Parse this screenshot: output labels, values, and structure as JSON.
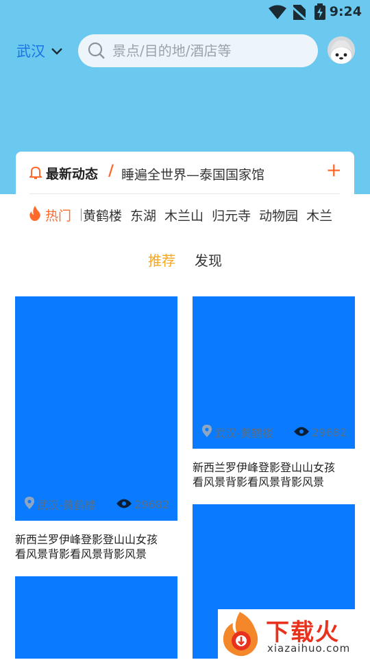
{
  "status_bar": {
    "time": "9:24",
    "icons": [
      "wifi-icon",
      "no-sim-icon",
      "battery-charging-icon"
    ]
  },
  "header": {
    "city": "武汉",
    "search_placeholder": "景点/目的地/酒店等",
    "colors": {
      "background": "#6bc8ee",
      "accent": "#1a73e8"
    }
  },
  "news": {
    "title": "最新动态",
    "text": "睡遍全世界—泰国国家馆",
    "accent_color": "#ff6a2b"
  },
  "hot": {
    "label": "热门",
    "items": [
      "黄鹤楼",
      "东湖",
      "木兰山",
      "归元寺",
      "动物园",
      "木兰"
    ]
  },
  "tabs": [
    {
      "label": "推荐",
      "active": true
    },
    {
      "label": "发现",
      "active": false
    }
  ],
  "cards": [
    {
      "location": "武汉-黄鹤楼",
      "views": "29682",
      "caption_line1": "新西兰罗伊峰登影登山山女孩",
      "caption_line2": "看风景背影看风景背影风景"
    },
    {
      "location": "武汉-黄鹤楼",
      "views": "29682",
      "caption_line1": "新西兰罗伊峰登影登山山女孩",
      "caption_line2": "看风景背影看风景背影风景"
    }
  ],
  "watermark": {
    "brand": "下载火",
    "url": "xiazaihuo.com"
  }
}
